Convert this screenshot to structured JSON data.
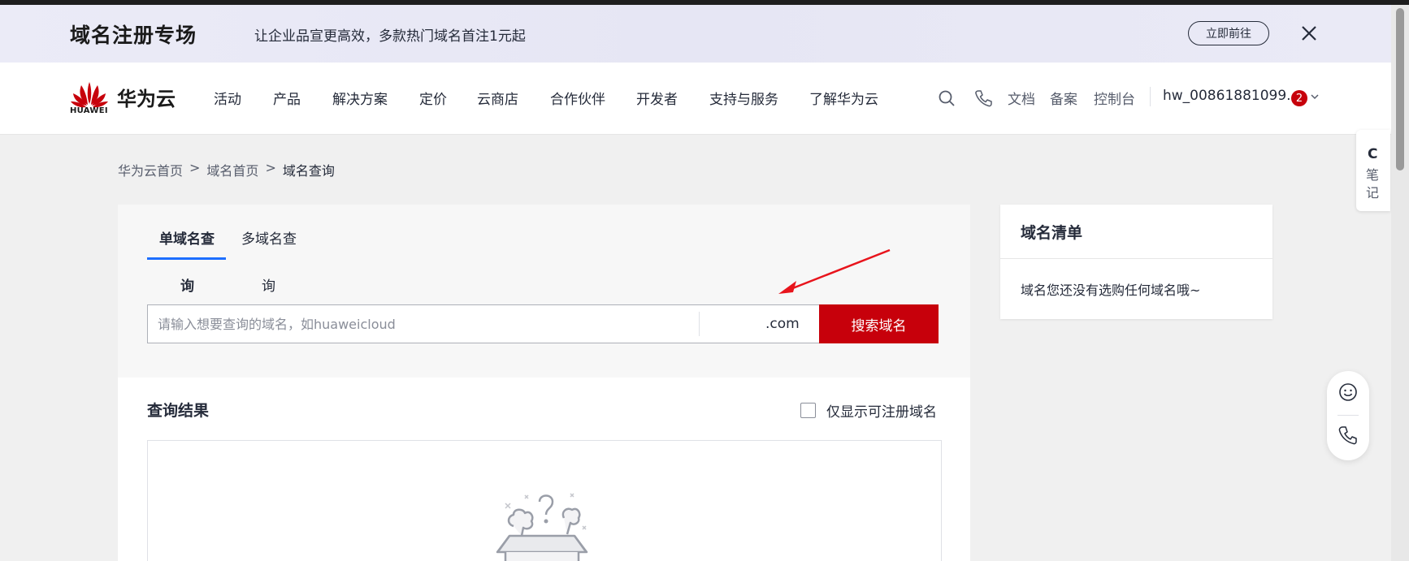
{
  "promo": {
    "title": "域名注册专场",
    "subtitle": "让企业品宣更高效，多款热门域名首注1元起",
    "button": "立即前往"
  },
  "nav": {
    "logo_text": "HUAWEI",
    "brand": "华为云",
    "items": [
      "活动",
      "产品",
      "解决方案",
      "定价",
      "云商店",
      "合作伙伴",
      "开发者",
      "支持与服务",
      "了解华为云"
    ],
    "links": [
      "文档",
      "备案",
      "控制台"
    ],
    "username": "hw_00861881099...",
    "badge_count": "2"
  },
  "breadcrumb": {
    "items": [
      "华为云首页",
      "域名首页",
      "域名查询"
    ],
    "separator": ">"
  },
  "search": {
    "tab_single": "单域名查",
    "tab_multi": "多域名查",
    "tab_single_2": "询",
    "tab_multi_2": "询",
    "placeholder": "请输入想要查询的域名，如huaweicloud",
    "tld": ".com",
    "button": "搜索域名"
  },
  "results": {
    "title": "查询结果",
    "filter_label": "仅显示可注册域名"
  },
  "cart": {
    "title": "域名清单",
    "empty_text": "域名您还没有选购任何域名哦~"
  },
  "side_note": {
    "letter": "C",
    "line1": "笔",
    "line2": "记"
  },
  "colors": {
    "brand_red": "#c7000b",
    "tab_active": "#1e6fff",
    "annotation_arrow": "#e8141c"
  }
}
